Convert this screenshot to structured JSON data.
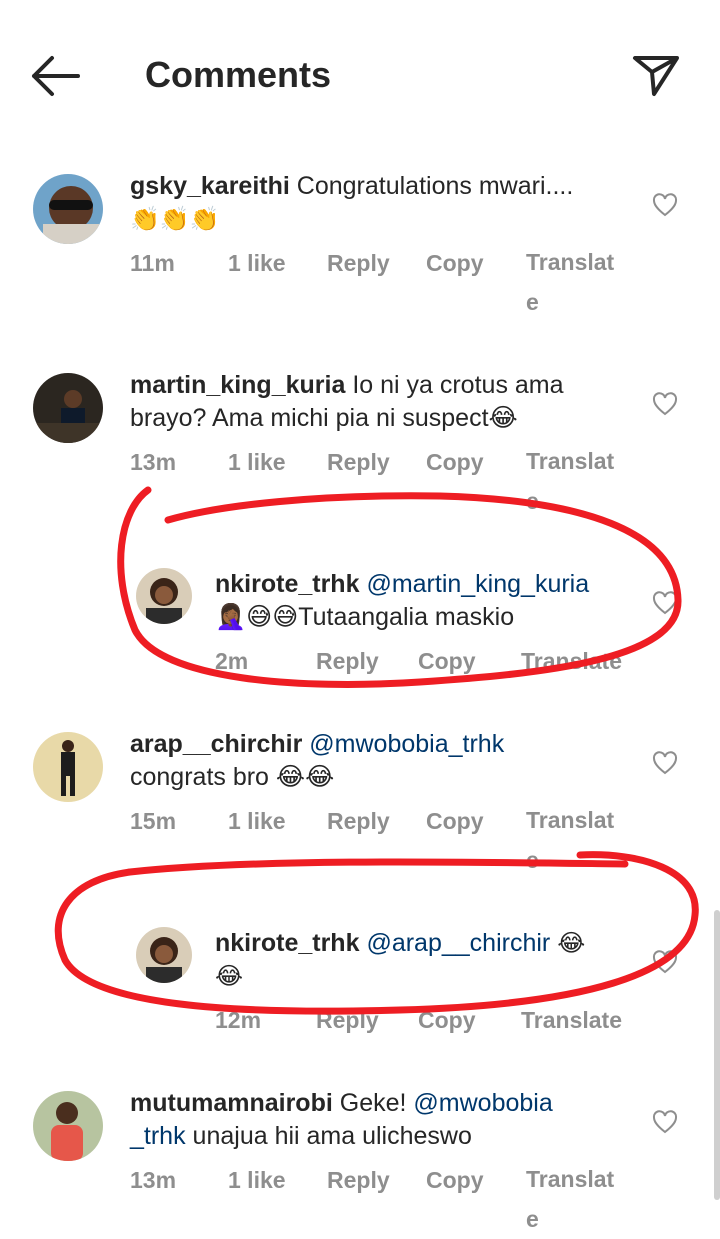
{
  "header": {
    "title": "Comments"
  },
  "comments": [
    {
      "username": "gsky_kareithi",
      "text": "Congratulations mwari....",
      "emojis": "👏👏👏",
      "time": "11m",
      "likes": "1 like",
      "reply": "Reply",
      "copy": "Copy",
      "translate": "Translate"
    },
    {
      "username": "martin_king_kuria",
      "text1": "Io ni ya crotus ama",
      "text2": "brayo? Ama michi pia ni suspect😂",
      "time": "13m",
      "likes": "1 like",
      "reply": "Reply",
      "copy": "Copy",
      "translate": "Translate"
    },
    {
      "username": "nkirote_trhk",
      "mention": "@martin_king_kuria",
      "text": "🤦🏾‍♀️😅😅Tutaangalia maskio",
      "time": "2m",
      "reply": "Reply",
      "copy": "Copy",
      "translate": "Translate"
    },
    {
      "username": "arap__chirchir",
      "mention": "@mwobobia_trhk",
      "text": "congrats bro 😂😂",
      "time": "15m",
      "likes": "1 like",
      "reply": "Reply",
      "copy": "Copy",
      "translate": "Translate"
    },
    {
      "username": "nkirote_trhk",
      "mention": "@arap__chirchir",
      "emoji1": "😂",
      "emoji2": "😂",
      "time": "12m",
      "reply": "Reply",
      "copy": "Copy",
      "translate": "Translate"
    },
    {
      "username": "mutumamnairobi",
      "text1": "Geke!",
      "mention1": "@mwobobia",
      "mention2": "_trhk",
      "text2": "unajua hii ama ulicheswo",
      "time": "13m",
      "likes": "1 like",
      "reply": "Reply",
      "copy": "Copy",
      "translate": "Translate"
    }
  ],
  "colors": {
    "text": "#262626",
    "meta": "#8e8e8e",
    "mention": "#00376b",
    "annotation": "#ee1d23"
  }
}
